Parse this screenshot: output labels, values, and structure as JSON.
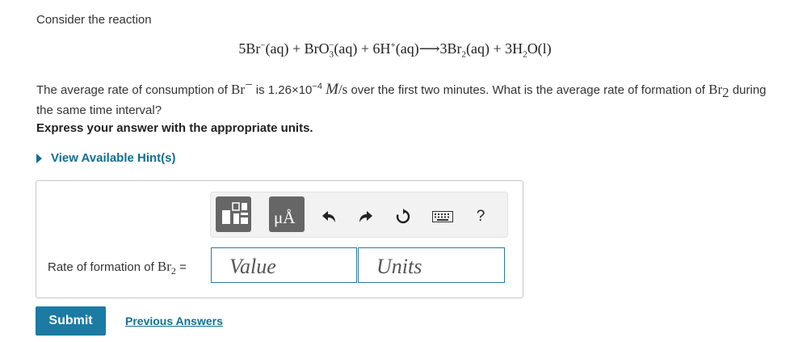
{
  "intro": "Consider the reaction",
  "equation": {
    "coef_br": "5",
    "br": "Br",
    "br_charge": "−",
    "aq1": "(aq) + ",
    "bro": "BrO",
    "bro_sub": "3",
    "bro_sup": "−",
    "aq2": "(aq) + 6H",
    "h_sup": "+",
    "aq3": "(aq)⟶3Br",
    "br2_sub": "2",
    "aq4": "(aq) + 3H",
    "h2o_sub": "2",
    "tail": "O(l)"
  },
  "question": {
    "p1": "The average rate of consumption of ",
    "br": "Br",
    "br_sup": "−",
    "p2": " is 1.26×10",
    "exp": "−4",
    "unit_m": "M",
    "unit_s": "/s",
    "p3": " over the first two minutes. What is the average rate of formation of ",
    "br2": "Br",
    "br2_sub": "2",
    "p4": " during the same time interval?"
  },
  "instruction": "Express your answer with the appropriate units.",
  "hints_label": "View Available Hint(s)",
  "toolbar": {
    "units_button_text": "μÅ",
    "help_text": "?",
    "icons": [
      "templates-icon",
      "units-icon",
      "undo-icon",
      "redo-icon",
      "reset-icon",
      "keyboard-icon",
      "help-icon"
    ]
  },
  "answer": {
    "label_prefix": "Rate of formation of ",
    "label_br": "Br",
    "label_sub": "2",
    "label_eq": " =",
    "value_placeholder": "Value",
    "units_placeholder": "Units"
  },
  "submit_label": "Submit",
  "previous_answers_label": "Previous Answers",
  "colors": {
    "link": "#146e91",
    "submit_bg": "#1b7ba3",
    "field_border": "#2b78a8",
    "toolbar_button": "#666666"
  }
}
